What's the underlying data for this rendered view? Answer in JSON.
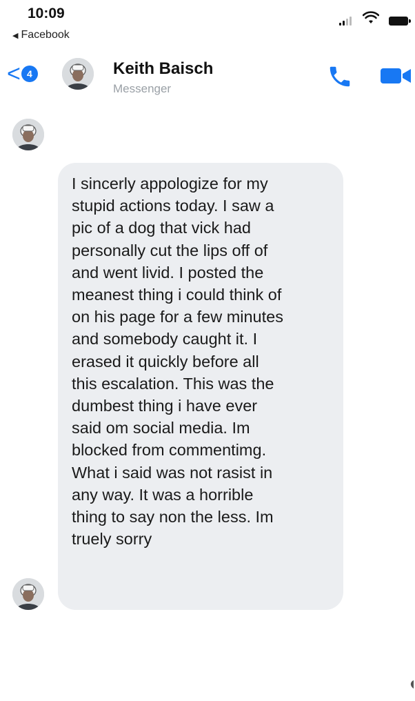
{
  "status_bar": {
    "time": "10:09",
    "back_app_label": "Facebook"
  },
  "header": {
    "unread_count": "4",
    "contact_name": "Keith Baisch",
    "subtitle": "Messenger",
    "icons": [
      "back-chevron-icon",
      "avatar",
      "phone-icon",
      "video-camera-icon"
    ],
    "accent_color": "#1878f3"
  },
  "conversation": {
    "messages": [
      {
        "sender": "Keith Baisch",
        "text": "I sincerly appologize for my\nstupid actions today. I saw a\npic of a dog that vick had\npersonally cut the lips off of\nand went livid. I posted the\nmeanest thing i could think of\non his page for a few minutes\nand somebody caught it. I\nerased it quickly before all\nthis escalation. This was the\ndumbest thing i have ever\nsaid om social media. Im\nblocked from commentimg.\nWhat i said was not rasist in\nany way. It was a horrible\nthing to say non the less. Im\ntruely sorry"
      }
    ],
    "bubble_color": "#eceef1"
  }
}
